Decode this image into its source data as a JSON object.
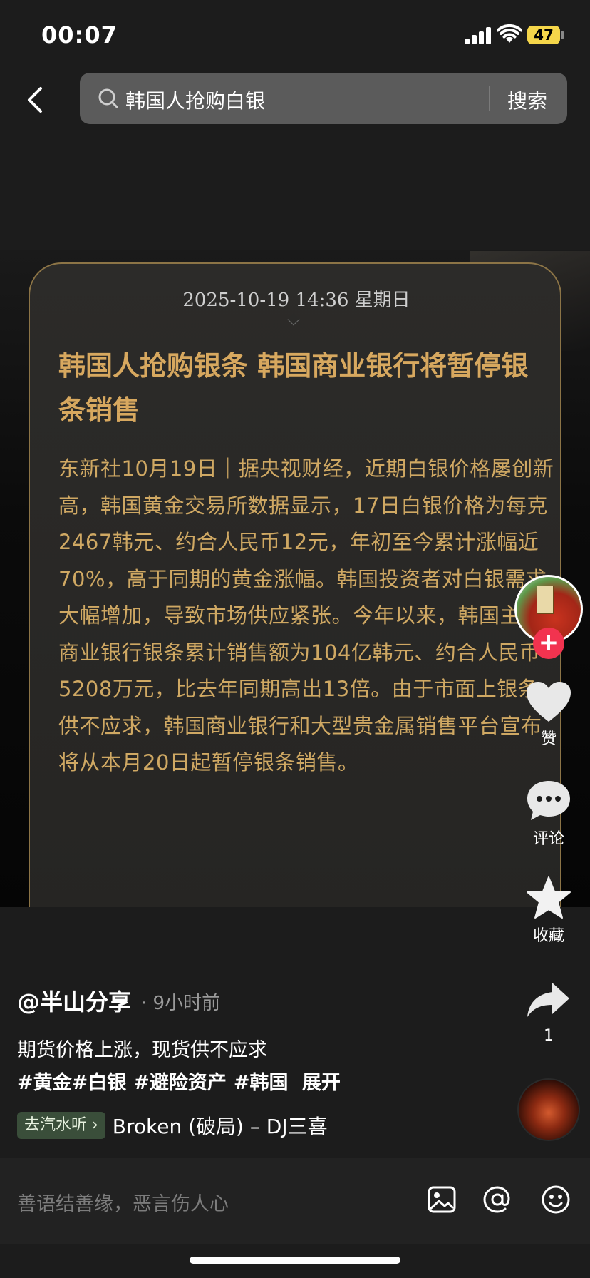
{
  "status_bar": {
    "time": "00:07",
    "battery": "47"
  },
  "search": {
    "query": "韩国人抢购白银",
    "button_label": "搜索"
  },
  "news_card": {
    "date": "2025-10-19 14:36 星期日",
    "headline": "韩国人抢购银条 韩国商业银行将暂停银条销售",
    "body": "东新社10月19日｜据央视财经，近期白银价格屡创新高，韩国黄金交易所数据显示，17日白银价格为每克2467韩元、约合人民币12元，年初至今累计涨幅近70%，高于同期的黄金涨幅。韩国投资者对白银需求大幅增加，导致市场供应紧张。今年以来，韩国主要商业银行银条累计销售额为104亿韩元、约合人民币5208万元，比去年同期高出13倍。由于市面上银条供不应求，韩国商业银行和大型贵金属销售平台宣布将从本月20日起暂停银条销售。"
  },
  "right_rail": {
    "like_label": "赞",
    "comment_label": "评论",
    "favorite_label": "收藏",
    "share_count": "1"
  },
  "caption": {
    "author": "@半山分享",
    "time_ago": "· 9小时前",
    "text": "期货价格上涨，现货供不应求",
    "hashtags": [
      "#黄金",
      "#白银",
      "#避险资产",
      "#韩国"
    ],
    "expand": "展开",
    "music_badge": "去汽水听 ›",
    "music_title": "Broken (破局) – DJ三喜"
  },
  "comment_bar": {
    "placeholder": "善语结善缘，恶言伤人心"
  },
  "colors": {
    "accent_gold": "#d7a85f",
    "follow_red": "#f2334f",
    "battery_yellow": "#f5d64a"
  }
}
